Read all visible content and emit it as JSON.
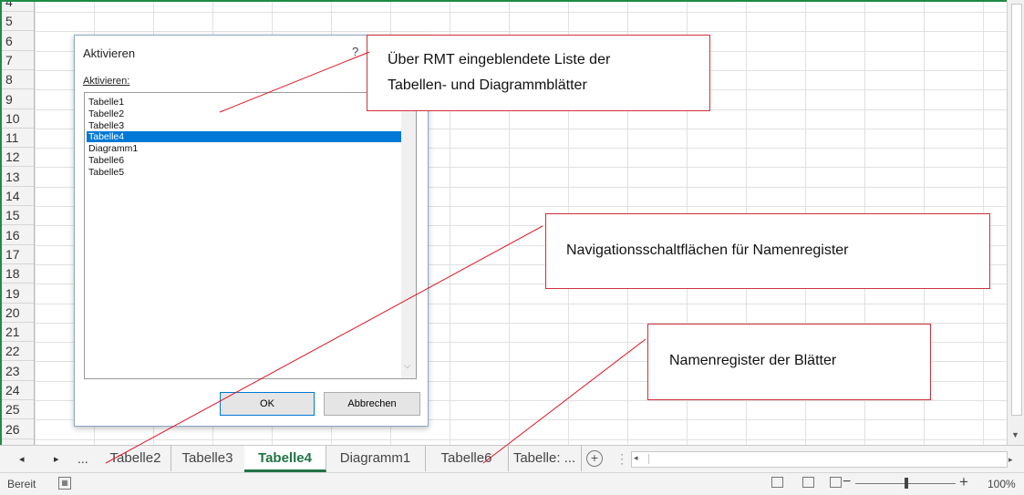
{
  "rows": [
    "4",
    "5",
    "6",
    "7",
    "8",
    "9",
    "10",
    "11",
    "12",
    "13",
    "14",
    "15",
    "16",
    "17",
    "18",
    "19",
    "20",
    "21",
    "22",
    "23",
    "24",
    "25",
    "26"
  ],
  "sheet_nav": {
    "prev": "◂",
    "next": "▸",
    "more": "..."
  },
  "tabs": [
    {
      "label": "Tabelle2",
      "active": false
    },
    {
      "label": "Tabelle3",
      "active": false
    },
    {
      "label": "Tabelle4",
      "active": true
    },
    {
      "label": "Diagramm1",
      "active": false
    },
    {
      "label": "Tabelle6",
      "active": false
    },
    {
      "label": "Tabelle: ...",
      "active": false
    }
  ],
  "add_sheet": "+",
  "status": {
    "text": "Bereit",
    "zoom": "100%"
  },
  "dialog": {
    "title": "Aktivieren",
    "help": "?",
    "label": "Aktivieren:",
    "items": [
      "Tabelle1",
      "Tabelle2",
      "Tabelle3",
      "Tabelle4",
      "Diagramm1",
      "Tabelle6",
      "Tabelle5"
    ],
    "selected_index": 3,
    "ok": "OK",
    "cancel": "Abbrechen"
  },
  "callouts": {
    "list_line1": "Über RMT eingeblendete Liste der",
    "list_line2": "Tabellen- und Diagrammblätter",
    "nav": "Navigationsschaltflächen für Namenregister",
    "tabs": "Namenregister der Blätter"
  },
  "colors": {
    "excel_green": "#217346",
    "selection": "#0078d7",
    "callout_border": "#d0303a"
  }
}
